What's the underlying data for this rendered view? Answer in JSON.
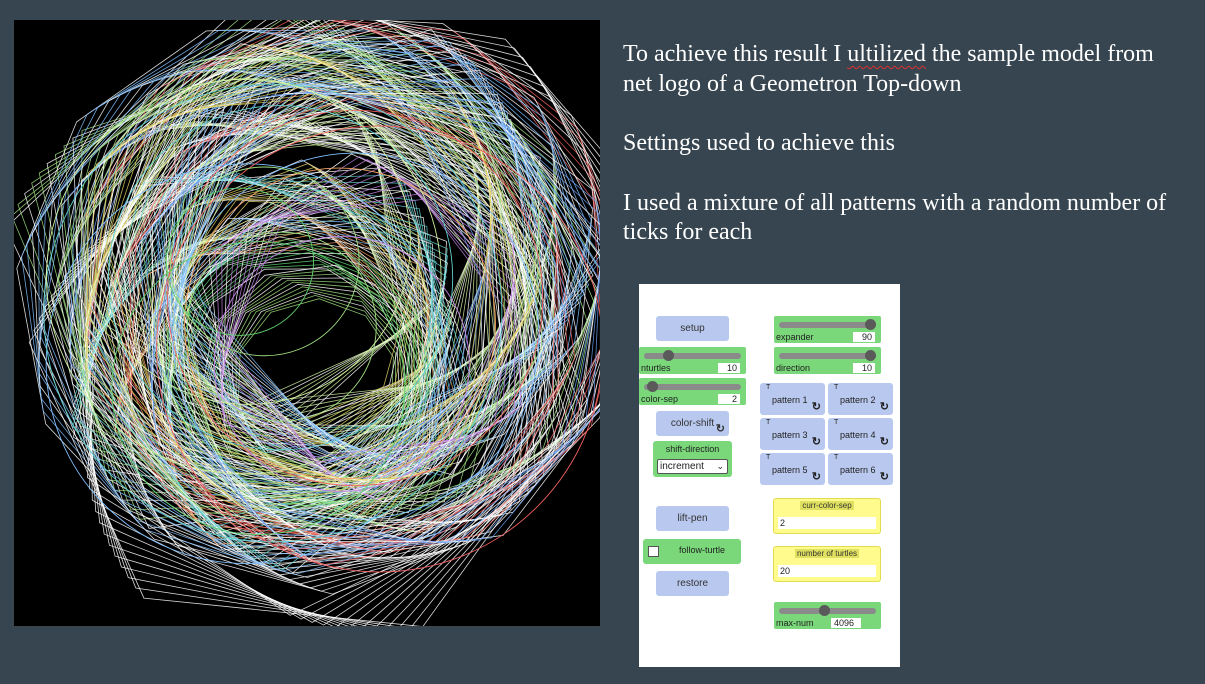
{
  "notes": {
    "p1_before": "To achieve this result I ",
    "p1_misspelled": "ultilized",
    "p1_after": " the sample model from net logo of a Geometron Top-down",
    "p2": "Settings used to achieve this",
    "p3": "I used a mixture of all patterns with a random number of ticks for each"
  },
  "panel": {
    "setup_label": "setup",
    "nturtles": {
      "label": "nturtles",
      "value": "10",
      "fraction": 0.22
    },
    "color_sep": {
      "label": "color-sep",
      "value": "2",
      "fraction": 0.05
    },
    "color_shift_label": "color-shift",
    "shift_direction": {
      "label": "shift-direction",
      "selected": "increment",
      "options": [
        "increment"
      ]
    },
    "lift_pen_label": "lift-pen",
    "follow_turtle_label": "follow-turtle",
    "follow_turtle_checked": false,
    "restore_label": "restore",
    "expander": {
      "label": "expander",
      "value": "90",
      "fraction": 1.0
    },
    "direction": {
      "label": "direction",
      "value": "10",
      "fraction": 1.0
    },
    "patterns": [
      {
        "t": "T",
        "label": "pattern 1",
        "icon": "forever-icon",
        "glyph": "↻"
      },
      {
        "t": "T",
        "label": "pattern 2",
        "icon": "forever-icon",
        "glyph": "↻"
      },
      {
        "t": "T",
        "label": "pattern 3",
        "icon": "forever-icon",
        "glyph": "↻"
      },
      {
        "t": "T",
        "label": "pattern 4",
        "icon": "forever-icon",
        "glyph": "↻"
      },
      {
        "t": "T",
        "label": "pattern 5",
        "icon": "forever-icon",
        "glyph": "↻"
      },
      {
        "t": "T",
        "label": "pattern 6",
        "icon": "forever-icon",
        "glyph": "↻"
      }
    ],
    "color_shift_glyph": "↻",
    "curr_color_sep": {
      "label": "curr-color-sep",
      "value": "2"
    },
    "number_of_turtles": {
      "label": "number of turtles",
      "value": "20"
    },
    "max_num": {
      "label": "max-num",
      "value": "4096",
      "fraction": 0.5
    }
  },
  "colors": {
    "background": "#36454f",
    "button": "#b8c8ee",
    "slider": "#7ad87a",
    "monitor": "#fffb8c"
  }
}
